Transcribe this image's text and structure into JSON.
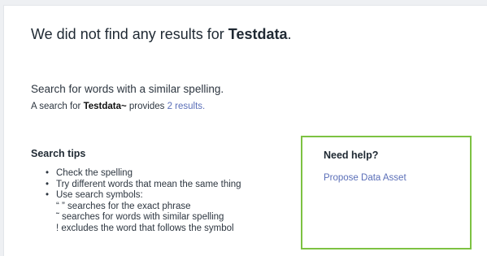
{
  "results": {
    "headline_prefix": "We did not find any results for ",
    "query": "Testdata",
    "headline_suffix": "."
  },
  "suggestion": {
    "heading": "Search for words with a similar spelling.",
    "prefix": "A search for ",
    "fuzzy_query": "Testdata~",
    "middle": " provides ",
    "link_text": "2 results."
  },
  "tips": {
    "title": "Search tips",
    "items": [
      "Check the spelling",
      "Try different words that mean the same thing",
      "Use search symbols:"
    ],
    "symbols": [
      "“ ” searches for the exact phrase",
      "˜ searches for words with similar spelling",
      "! excludes the word that follows the symbol"
    ]
  },
  "help": {
    "title": "Need help?",
    "link_text": "Propose Data Asset",
    "border_color": "#7dc242"
  },
  "colors": {
    "link": "#5b6fb8",
    "text": "#1f2933"
  }
}
